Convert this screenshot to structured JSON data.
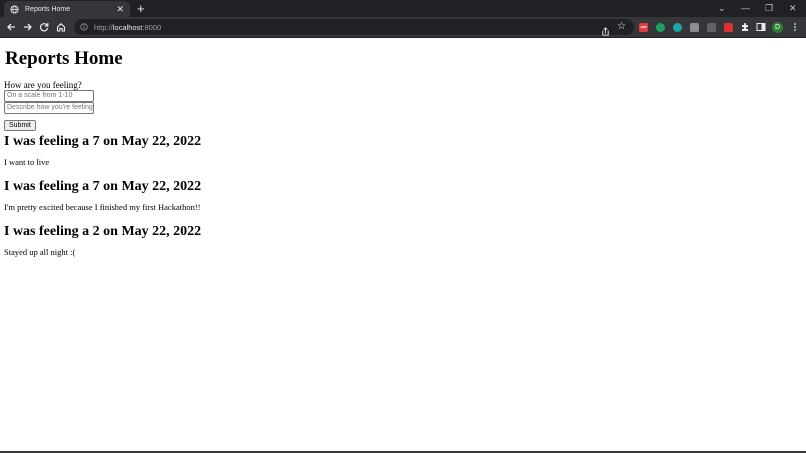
{
  "browser": {
    "tab_title": "Reports Home",
    "tab_close": "✕",
    "new_tab": "+",
    "url_scheme": "http://",
    "url_host": "localhost",
    "url_port": ":8000",
    "window_controls": [
      "⌄",
      "—",
      "❐",
      "✕"
    ],
    "profile_initial": "D",
    "extension_abp": "ABP",
    "accent_colors": {
      "chrome_bg": "#202124",
      "toolbar_bg": "#35363a",
      "text": "#e8eaed"
    }
  },
  "page": {
    "title": "Reports Home",
    "form": {
      "label": "How are you feeling?",
      "rating_placeholder": "On a scale from 1-10",
      "description_placeholder": "Describe how you're feeling",
      "submit_label": "Submit"
    },
    "reports": [
      {
        "heading": "I was feeling a 7 on May 22, 2022",
        "text": "I want to live"
      },
      {
        "heading": "I was feeling a 7 on May 22, 2022",
        "text": "I'm pretty excited because I finished my first Hackathon!!"
      },
      {
        "heading": "I was feeling a 2 on May 22, 2022",
        "text": "Stayed up all night :("
      }
    ]
  }
}
